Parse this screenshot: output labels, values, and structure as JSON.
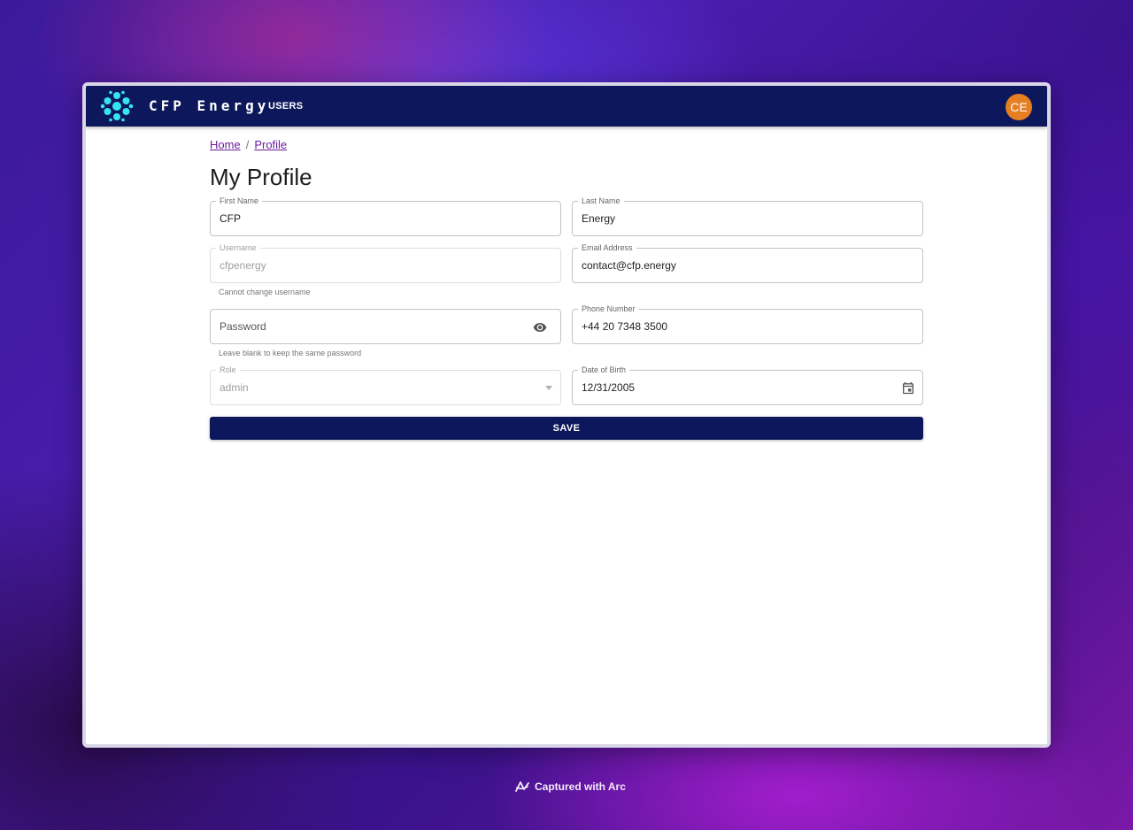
{
  "appbar": {
    "brand": "CFP Energy",
    "nav_users": "USERS",
    "avatar_initials": "CE"
  },
  "breadcrumb": {
    "home": "Home",
    "separator": "/",
    "profile": "Profile"
  },
  "page_title": "My Profile",
  "form": {
    "first_name": {
      "label": "First Name",
      "value": "CFP"
    },
    "last_name": {
      "label": "Last Name",
      "value": "Energy"
    },
    "username": {
      "label": "Username",
      "value": "cfpenergy",
      "helper": "Cannot change username"
    },
    "email": {
      "label": "Email Address",
      "value": "contact@cfp.energy"
    },
    "password": {
      "placeholder": "Password",
      "helper": "Leave blank to keep the same password"
    },
    "phone": {
      "label": "Phone Number",
      "value": "+44 20 7348 3500"
    },
    "role": {
      "label": "Role",
      "value": "admin"
    },
    "dob": {
      "label": "Date of Birth",
      "value": "12/31/2005"
    },
    "save_label": "SAVE"
  },
  "footer_caption": "Captured with Arc",
  "colors": {
    "appbar": "#0d185c",
    "logo": "#35e4f2",
    "avatar": "#e67e22",
    "link": "#6a1b9a"
  }
}
